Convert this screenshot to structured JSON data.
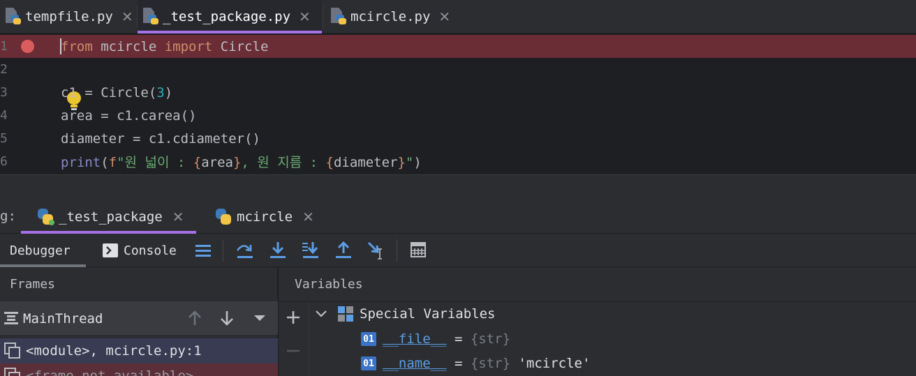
{
  "editor_tabs": [
    {
      "label": "tempfile.py",
      "active": false
    },
    {
      "label": "_test_package.py",
      "active": true
    },
    {
      "label": "mcircle.py",
      "active": false
    }
  ],
  "code": {
    "line_numbers": [
      "1",
      "2",
      "3",
      "4",
      "5",
      "6"
    ],
    "l1": {
      "kw1": "from",
      "mod": " mcircle ",
      "kw2": "import",
      "cls": " Circle"
    },
    "l3": {
      "a": "c1 = Circle(",
      "n": "3",
      "b": ")"
    },
    "l4": "area = c1.carea()",
    "l5": "diameter = c1.cdiameter()",
    "l6": {
      "fn": "print",
      "p1": "(",
      "f": "f",
      "s1": "\"원 넓이 : ",
      "b1": "{",
      "v1": "area",
      "b2": "}",
      "s2": ", 원 지름 : ",
      "b3": "{",
      "v2": "diameter",
      "b4": "}",
      "s3": "\"",
      "p2": ")"
    }
  },
  "debug": {
    "label": "g:",
    "tabs": [
      {
        "label": "_test_package",
        "active": true
      },
      {
        "label": "mcircle",
        "active": false
      }
    ]
  },
  "toolbar": {
    "debugger_label": "Debugger",
    "console_label": "Console"
  },
  "frames": {
    "title": "Frames",
    "thread": "MainThread",
    "rows": [
      "<module>, mcircle.py:1",
      "<frame not available>"
    ]
  },
  "variables": {
    "title": "Variables",
    "group": "Special Variables",
    "items": [
      {
        "badge": "01",
        "name": "__file__",
        "eq": " = ",
        "type": "{str}",
        "value": ""
      },
      {
        "badge": "01",
        "name": "__name__",
        "eq": " = ",
        "type": "{str}",
        "value": " 'mcircle'"
      }
    ]
  },
  "colors": {
    "accent": "#a571e6",
    "breakpoint": "#db5c5c",
    "highlight_line": "#6a2c35"
  }
}
